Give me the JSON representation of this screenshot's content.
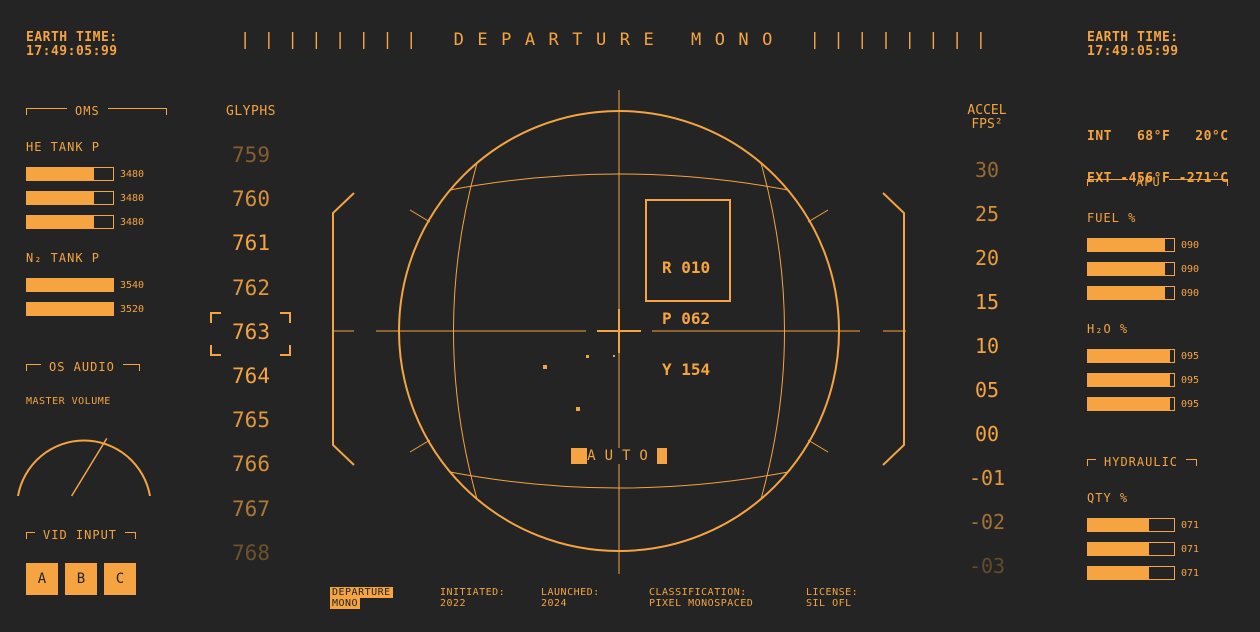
{
  "header": {
    "earth_time_label": "EARTH TIME:",
    "earth_time_left": "17:49:05:99",
    "earth_time_right": "17:49:05:99",
    "title": "||||||||  DEPARTURE  MONO  ||||||||"
  },
  "temps": {
    "int_line": "INT   68°F   20°C",
    "ext_line": "EXT -456°F -271°C"
  },
  "oms": {
    "title": "OMS",
    "he_label": "HE TANK P",
    "he_tanks": [
      {
        "value": "3480",
        "level": 0.78
      },
      {
        "value": "3480",
        "level": 0.78
      },
      {
        "value": "3480",
        "level": 0.78
      }
    ],
    "n2_label": "N₂ TANK P",
    "n2_tanks": [
      {
        "value": "3540",
        "level": 1.0
      },
      {
        "value": "3520",
        "level": 1.0
      }
    ]
  },
  "audio": {
    "title": "OS AUDIO",
    "master_label": "MASTER VOLUME",
    "volume_level": 0.62
  },
  "vid_input": {
    "title": "VID INPUT",
    "buttons": [
      "A",
      "B",
      "C"
    ]
  },
  "glyphs": {
    "title": "GLYPHS",
    "values": [
      "759",
      "760",
      "761",
      "762",
      "763",
      "764",
      "765",
      "766",
      "767",
      "768"
    ],
    "selected": "763"
  },
  "accel": {
    "title_line1": "ACCEL",
    "title_line2": "FPS²",
    "values": [
      "30",
      "25",
      "20",
      "15",
      "10",
      "05",
      "00",
      "-01",
      "-02",
      "-03"
    ]
  },
  "attitude": {
    "r_line": "R 010",
    "p_line": "P 062",
    "y_line": "Y 154",
    "mode": "AUTO"
  },
  "apu": {
    "title": "APU",
    "fuel_label": "FUEL %",
    "fuel": [
      {
        "value": "090",
        "level": 0.9
      },
      {
        "value": "090",
        "level": 0.9
      },
      {
        "value": "090",
        "level": 0.9
      }
    ],
    "h2o_label": "H₂O %",
    "h2o": [
      {
        "value": "095",
        "level": 0.95
      },
      {
        "value": "095",
        "level": 0.95
      },
      {
        "value": "095",
        "level": 0.95
      }
    ]
  },
  "hydraulic": {
    "title": "HYDRAULIC",
    "qty_label": "QTY %",
    "qty": [
      {
        "value": "071",
        "level": 0.71
      },
      {
        "value": "071",
        "level": 0.71
      },
      {
        "value": "071",
        "level": 0.71
      }
    ]
  },
  "footer": {
    "badge_line1": "DEPARTURE",
    "badge_line2": "MONO",
    "initiated_label": "INITIATED:",
    "initiated_value": "2022",
    "launched_label": "LAUNCHED:",
    "launched_value": "2024",
    "classification_label": "CLASSIFICATION:",
    "classification_value": "PIXEL MONOSPACED",
    "license_label": "LICENSE:",
    "license_value": "SIL OFL"
  },
  "colors": {
    "accent": "#f5a441",
    "background": "#242424"
  }
}
